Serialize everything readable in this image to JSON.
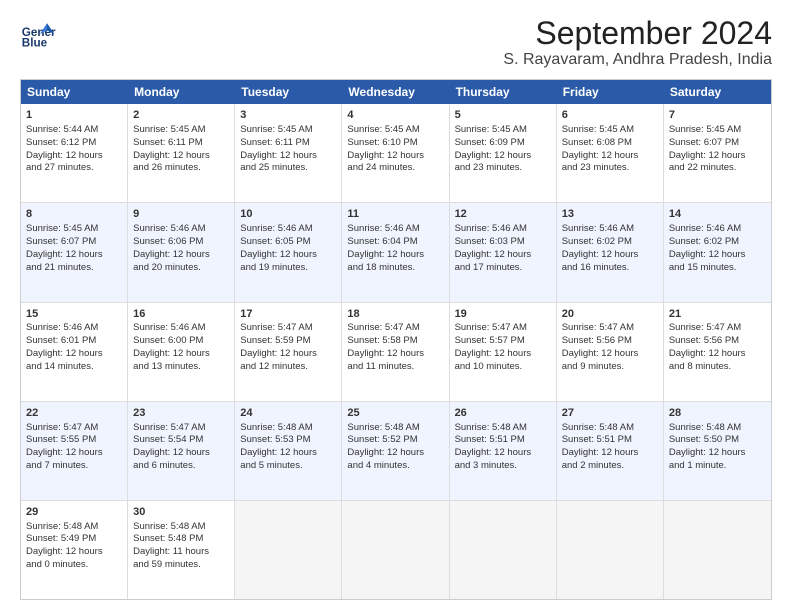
{
  "logo": {
    "line1": "General",
    "line2": "Blue"
  },
  "title": "September 2024",
  "subtitle": "S. Rayavaram, Andhra Pradesh, India",
  "days": [
    "Sunday",
    "Monday",
    "Tuesday",
    "Wednesday",
    "Thursday",
    "Friday",
    "Saturday"
  ],
  "rows": [
    [
      {
        "day": "1",
        "lines": [
          "Sunrise: 5:44 AM",
          "Sunset: 6:12 PM",
          "Daylight: 12 hours",
          "and 27 minutes."
        ]
      },
      {
        "day": "2",
        "lines": [
          "Sunrise: 5:45 AM",
          "Sunset: 6:11 PM",
          "Daylight: 12 hours",
          "and 26 minutes."
        ]
      },
      {
        "day": "3",
        "lines": [
          "Sunrise: 5:45 AM",
          "Sunset: 6:11 PM",
          "Daylight: 12 hours",
          "and 25 minutes."
        ]
      },
      {
        "day": "4",
        "lines": [
          "Sunrise: 5:45 AM",
          "Sunset: 6:10 PM",
          "Daylight: 12 hours",
          "and 24 minutes."
        ]
      },
      {
        "day": "5",
        "lines": [
          "Sunrise: 5:45 AM",
          "Sunset: 6:09 PM",
          "Daylight: 12 hours",
          "and 23 minutes."
        ]
      },
      {
        "day": "6",
        "lines": [
          "Sunrise: 5:45 AM",
          "Sunset: 6:08 PM",
          "Daylight: 12 hours",
          "and 23 minutes."
        ]
      },
      {
        "day": "7",
        "lines": [
          "Sunrise: 5:45 AM",
          "Sunset: 6:07 PM",
          "Daylight: 12 hours",
          "and 22 minutes."
        ]
      }
    ],
    [
      {
        "day": "8",
        "lines": [
          "Sunrise: 5:45 AM",
          "Sunset: 6:07 PM",
          "Daylight: 12 hours",
          "and 21 minutes."
        ]
      },
      {
        "day": "9",
        "lines": [
          "Sunrise: 5:46 AM",
          "Sunset: 6:06 PM",
          "Daylight: 12 hours",
          "and 20 minutes."
        ]
      },
      {
        "day": "10",
        "lines": [
          "Sunrise: 5:46 AM",
          "Sunset: 6:05 PM",
          "Daylight: 12 hours",
          "and 19 minutes."
        ]
      },
      {
        "day": "11",
        "lines": [
          "Sunrise: 5:46 AM",
          "Sunset: 6:04 PM",
          "Daylight: 12 hours",
          "and 18 minutes."
        ]
      },
      {
        "day": "12",
        "lines": [
          "Sunrise: 5:46 AM",
          "Sunset: 6:03 PM",
          "Daylight: 12 hours",
          "and 17 minutes."
        ]
      },
      {
        "day": "13",
        "lines": [
          "Sunrise: 5:46 AM",
          "Sunset: 6:02 PM",
          "Daylight: 12 hours",
          "and 16 minutes."
        ]
      },
      {
        "day": "14",
        "lines": [
          "Sunrise: 5:46 AM",
          "Sunset: 6:02 PM",
          "Daylight: 12 hours",
          "and 15 minutes."
        ]
      }
    ],
    [
      {
        "day": "15",
        "lines": [
          "Sunrise: 5:46 AM",
          "Sunset: 6:01 PM",
          "Daylight: 12 hours",
          "and 14 minutes."
        ]
      },
      {
        "day": "16",
        "lines": [
          "Sunrise: 5:46 AM",
          "Sunset: 6:00 PM",
          "Daylight: 12 hours",
          "and 13 minutes."
        ]
      },
      {
        "day": "17",
        "lines": [
          "Sunrise: 5:47 AM",
          "Sunset: 5:59 PM",
          "Daylight: 12 hours",
          "and 12 minutes."
        ]
      },
      {
        "day": "18",
        "lines": [
          "Sunrise: 5:47 AM",
          "Sunset: 5:58 PM",
          "Daylight: 12 hours",
          "and 11 minutes."
        ]
      },
      {
        "day": "19",
        "lines": [
          "Sunrise: 5:47 AM",
          "Sunset: 5:57 PM",
          "Daylight: 12 hours",
          "and 10 minutes."
        ]
      },
      {
        "day": "20",
        "lines": [
          "Sunrise: 5:47 AM",
          "Sunset: 5:56 PM",
          "Daylight: 12 hours",
          "and 9 minutes."
        ]
      },
      {
        "day": "21",
        "lines": [
          "Sunrise: 5:47 AM",
          "Sunset: 5:56 PM",
          "Daylight: 12 hours",
          "and 8 minutes."
        ]
      }
    ],
    [
      {
        "day": "22",
        "lines": [
          "Sunrise: 5:47 AM",
          "Sunset: 5:55 PM",
          "Daylight: 12 hours",
          "and 7 minutes."
        ]
      },
      {
        "day": "23",
        "lines": [
          "Sunrise: 5:47 AM",
          "Sunset: 5:54 PM",
          "Daylight: 12 hours",
          "and 6 minutes."
        ]
      },
      {
        "day": "24",
        "lines": [
          "Sunrise: 5:48 AM",
          "Sunset: 5:53 PM",
          "Daylight: 12 hours",
          "and 5 minutes."
        ]
      },
      {
        "day": "25",
        "lines": [
          "Sunrise: 5:48 AM",
          "Sunset: 5:52 PM",
          "Daylight: 12 hours",
          "and 4 minutes."
        ]
      },
      {
        "day": "26",
        "lines": [
          "Sunrise: 5:48 AM",
          "Sunset: 5:51 PM",
          "Daylight: 12 hours",
          "and 3 minutes."
        ]
      },
      {
        "day": "27",
        "lines": [
          "Sunrise: 5:48 AM",
          "Sunset: 5:51 PM",
          "Daylight: 12 hours",
          "and 2 minutes."
        ]
      },
      {
        "day": "28",
        "lines": [
          "Sunrise: 5:48 AM",
          "Sunset: 5:50 PM",
          "Daylight: 12 hours",
          "and 1 minute."
        ]
      }
    ],
    [
      {
        "day": "29",
        "lines": [
          "Sunrise: 5:48 AM",
          "Sunset: 5:49 PM",
          "Daylight: 12 hours",
          "and 0 minutes."
        ]
      },
      {
        "day": "30",
        "lines": [
          "Sunrise: 5:48 AM",
          "Sunset: 5:48 PM",
          "Daylight: 11 hours",
          "and 59 minutes."
        ]
      },
      {
        "day": "",
        "lines": []
      },
      {
        "day": "",
        "lines": []
      },
      {
        "day": "",
        "lines": []
      },
      {
        "day": "",
        "lines": []
      },
      {
        "day": "",
        "lines": []
      }
    ]
  ]
}
